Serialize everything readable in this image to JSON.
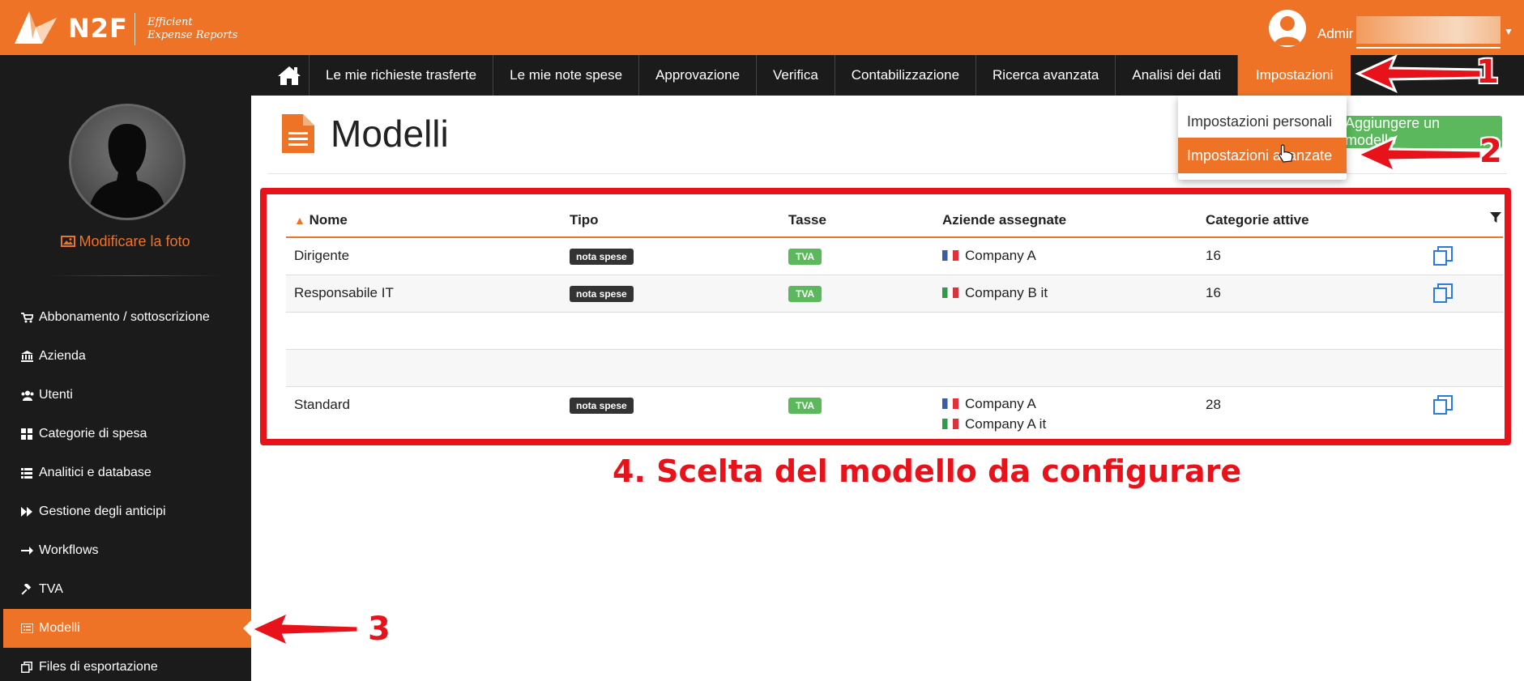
{
  "header": {
    "logo_text": "N2F",
    "logo_tagline_1": "Efficient",
    "logo_tagline_2": "Expense Reports",
    "user_name": "Admir"
  },
  "nav": {
    "items": [
      {
        "label": "Le mie richieste trasferte"
      },
      {
        "label": "Le mie note spese"
      },
      {
        "label": "Approvazione"
      },
      {
        "label": "Verifica"
      },
      {
        "label": "Contabilizzazione"
      },
      {
        "label": "Ricerca avanzata"
      },
      {
        "label": "Analisi dei dati"
      },
      {
        "label": "Impostazioni",
        "active": true
      }
    ]
  },
  "dropdown": {
    "personal": "Impostazioni personali",
    "advanced": "Impostazioni avanzate"
  },
  "sidebar": {
    "change_photo": "Modificare la foto",
    "items": [
      {
        "label": "Abbonamento / sottoscrizione",
        "icon": "cart-icon"
      },
      {
        "label": "Azienda",
        "icon": "bank-icon"
      },
      {
        "label": "Utenti",
        "icon": "users-icon"
      },
      {
        "label": "Categorie di spesa",
        "icon": "grid-icon"
      },
      {
        "label": "Analitici e database",
        "icon": "table-icon"
      },
      {
        "label": "Gestione degli anticipi",
        "icon": "fast-forward-icon"
      },
      {
        "label": "Workflows",
        "icon": "arrow-right-icon"
      },
      {
        "label": "TVA",
        "icon": "gavel-icon"
      },
      {
        "label": "Modelli",
        "icon": "list-icon",
        "active": true
      },
      {
        "label": "Files di esportazione",
        "icon": "copy-icon"
      }
    ]
  },
  "main": {
    "title": "Modelli",
    "add_button": "Aggiungere un modello",
    "table": {
      "headers": {
        "name": "Nome",
        "type": "Tipo",
        "tax": "Tasse",
        "companies": "Aziende assegnate",
        "categories": "Categorie attive"
      },
      "rows": [
        {
          "name": "Dirigente",
          "type": "nota spese",
          "tax": "TVA",
          "companies": [
            "Company A"
          ],
          "categories": "16"
        },
        {
          "name": "Responsabile IT",
          "type": "nota spese",
          "tax": "TVA",
          "companies": [
            "Company B it"
          ],
          "categories": "16"
        },
        {
          "name": "Standard",
          "type": "nota spese",
          "tax": "TVA",
          "companies": [
            "Company A",
            "Company A it"
          ],
          "categories": "28"
        }
      ]
    }
  },
  "annotations": {
    "one": "1",
    "two": "2",
    "three": "3",
    "four": "4. Scelta del modello da configurare"
  },
  "colors": {
    "brand": "#ef7327",
    "dark": "#1b1b1b",
    "success": "#5cb85c",
    "annotation": "#e8121a"
  }
}
